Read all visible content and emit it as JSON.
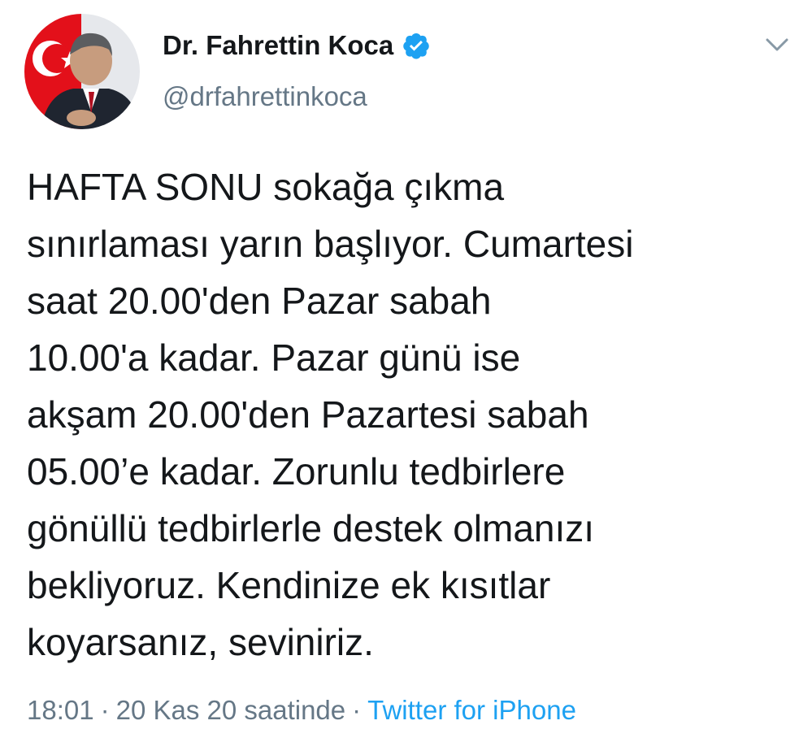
{
  "author": {
    "display_name": "Dr. Fahrettin Koca",
    "handle": "@drfahrettinkoca",
    "verified": true,
    "avatar_icon": "profile-photo"
  },
  "tweet": {
    "lines": [
      "HAFTA SONU sokağa çıkma",
      "sınırlaması yarın başlıyor. Cumartesi",
      "saat 20.00'den Pazar sabah",
      "10.00'a kadar. Pazar günü ise",
      "akşam 20.00'den Pazartesi sabah",
      "05.00’e kadar. Zorunlu tedbirlere",
      "gönüllü tedbirlerle destek olmanızı",
      "bekliyoruz. Kendinize ek kısıtlar",
      "koyarsanız, seviniriz."
    ]
  },
  "meta": {
    "time": "18:01",
    "sep1": "·",
    "date": "20 Kas 20 saatinde",
    "sep2": "·",
    "source": "Twitter for iPhone"
  },
  "colors": {
    "text": "#14171a",
    "secondary": "#657786",
    "accent": "#1da1f2"
  }
}
